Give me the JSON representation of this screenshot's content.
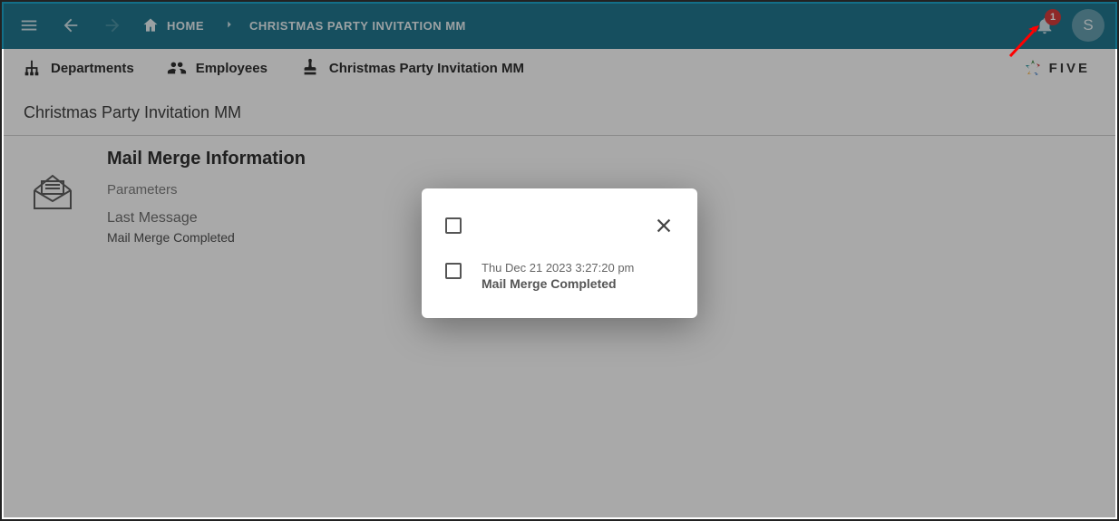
{
  "appbar": {
    "home_label": "HOME",
    "breadcrumb_current": "CHRISTMAS PARTY INVITATION MM",
    "notification_count": "1",
    "avatar_initial": "S"
  },
  "subnav": {
    "items": [
      {
        "label": "Departments"
      },
      {
        "label": "Employees"
      },
      {
        "label": "Christmas Party Invitation MM"
      }
    ],
    "brand_text": "FIVE"
  },
  "page": {
    "title": "Christmas Party Invitation MM",
    "section_heading": "Mail Merge Information",
    "parameters_label": "Parameters",
    "last_message_label": "Last Message",
    "last_message_value": "Mail Merge Completed"
  },
  "modal": {
    "notifications": [
      {
        "timestamp": "Thu Dec 21 2023 3:27:20 pm",
        "message": "Mail Merge Completed"
      }
    ]
  }
}
